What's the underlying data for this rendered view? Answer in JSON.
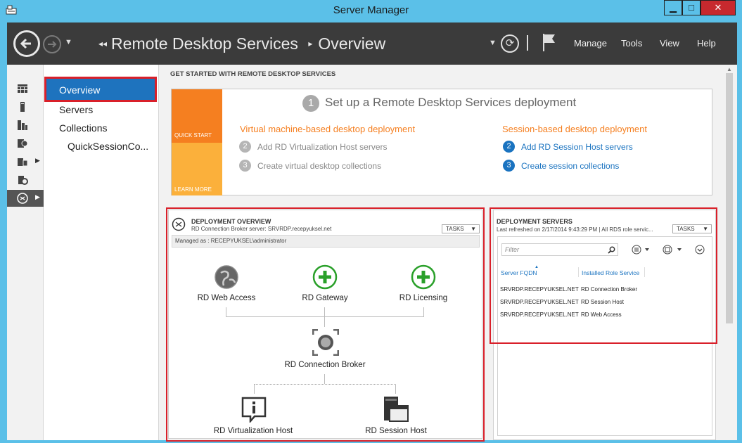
{
  "window": {
    "title": "Server Manager"
  },
  "header": {
    "breadcrumb_root": "Remote Desktop Services",
    "breadcrumb_page": "Overview",
    "menu": {
      "manage": "Manage",
      "tools": "Tools",
      "view": "View",
      "help": "Help"
    }
  },
  "nav": {
    "items": [
      {
        "label": "Overview"
      },
      {
        "label": "Servers"
      },
      {
        "label": "Collections"
      },
      {
        "label": "QuickSessionCo..."
      }
    ]
  },
  "get_started": {
    "title": "GET STARTED WITH REMOTE DESKTOP SERVICES",
    "quick_start": "QUICK START",
    "learn_more": "LEARN MORE",
    "step_number": "1",
    "heading": "Set up a Remote Desktop Services deployment",
    "vm_title": "Virtual machine-based desktop deployment",
    "vm_steps": [
      {
        "num": "2",
        "text": "Add RD Virtualization Host servers"
      },
      {
        "num": "3",
        "text": "Create virtual desktop collections"
      }
    ],
    "session_title": "Session-based desktop deployment",
    "session_steps": [
      {
        "num": "2",
        "text": "Add RD Session Host servers"
      },
      {
        "num": "3",
        "text": "Create session collections"
      }
    ]
  },
  "deployment_overview": {
    "title": "DEPLOYMENT OVERVIEW",
    "subtitle": "RD Connection Broker server: SRVRDP.recepyuksel.net",
    "tasks": "TASKS",
    "managed_as": "Managed as : RECEPYUKSEL\\administrator",
    "roles": {
      "web_access": "RD Web Access",
      "gateway": "RD Gateway",
      "licensing": "RD Licensing",
      "broker": "RD Connection Broker",
      "virt_host": "RD Virtualization Host",
      "session_host": "RD Session Host"
    }
  },
  "deployment_servers": {
    "title": "DEPLOYMENT SERVERS",
    "subtitle": "Last refreshed on 2/17/2014 9:43:29 PM | All RDS role servic...",
    "tasks": "TASKS",
    "filter_placeholder": "Filter",
    "columns": [
      "Server FQDN",
      "Installed Role Service"
    ],
    "rows": [
      [
        "SRVRDP.RECEPYUKSEL.NET",
        "RD Connection Broker"
      ],
      [
        "SRVRDP.RECEPYUKSEL.NET",
        "RD Session Host"
      ],
      [
        "SRVRDP.RECEPYUKSEL.NET",
        "RD Web Access"
      ]
    ]
  },
  "colors": {
    "accent": "#1e73be",
    "highlight": "#d9202a",
    "orange": "#f57f20",
    "titlebar": "#5bc0e8"
  }
}
